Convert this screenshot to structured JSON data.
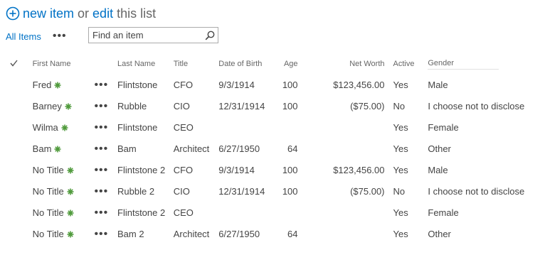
{
  "command": {
    "new_item": "new item",
    "or_text": "or",
    "edit": "edit",
    "this_list": "this list"
  },
  "view": {
    "current": "All Items",
    "more": "•••"
  },
  "search": {
    "placeholder": "Find an item"
  },
  "columns": {
    "first_name": "First Name",
    "last_name": "Last Name",
    "title": "Title",
    "dob": "Date of Birth",
    "age": "Age",
    "net_worth": "Net Worth",
    "active": "Active",
    "gender": "Gender"
  },
  "rows": [
    {
      "first": "Fred",
      "last": "Flintstone",
      "title": "CFO",
      "dob": "9/3/1914",
      "age": "100",
      "net": "$123,456.00",
      "active": "Yes",
      "gender": "Male"
    },
    {
      "first": "Barney",
      "last": "Rubble",
      "title": "CIO",
      "dob": "12/31/1914",
      "age": "100",
      "net": "($75.00)",
      "active": "No",
      "gender": "I choose not to disclose"
    },
    {
      "first": "Wilma",
      "last": "Flintstone",
      "title": "CEO",
      "dob": "",
      "age": "",
      "net": "",
      "active": "Yes",
      "gender": "Female"
    },
    {
      "first": "Bam",
      "last": "Bam",
      "title": "Architect",
      "dob": "6/27/1950",
      "age": "64",
      "net": "",
      "active": "Yes",
      "gender": "Other"
    },
    {
      "first": "No Title",
      "last": "Flintstone 2",
      "title": "CFO",
      "dob": "9/3/1914",
      "age": "100",
      "net": "$123,456.00",
      "active": "Yes",
      "gender": "Male"
    },
    {
      "first": "No Title",
      "last": "Rubble 2",
      "title": "CIO",
      "dob": "12/31/1914",
      "age": "100",
      "net": "($75.00)",
      "active": "No",
      "gender": "I choose not to disclose"
    },
    {
      "first": "No Title",
      "last": "Flintstone 2",
      "title": "CEO",
      "dob": "",
      "age": "",
      "net": "",
      "active": "Yes",
      "gender": "Female"
    },
    {
      "first": "No Title",
      "last": "Bam 2",
      "title": "Architect",
      "dob": "6/27/1950",
      "age": "64",
      "net": "",
      "active": "Yes",
      "gender": "Other"
    }
  ],
  "row_menu": "•••",
  "icons": {
    "new_item": "plus-circle-icon",
    "search": "magnifier-icon",
    "select_all": "checkmark-icon",
    "new_badge": "new-star-icon"
  },
  "colors": {
    "link": "#0072c6",
    "text": "#444444",
    "header_text": "#666666",
    "new_badge": "#4f9a3b",
    "search_border": "#ababab"
  }
}
